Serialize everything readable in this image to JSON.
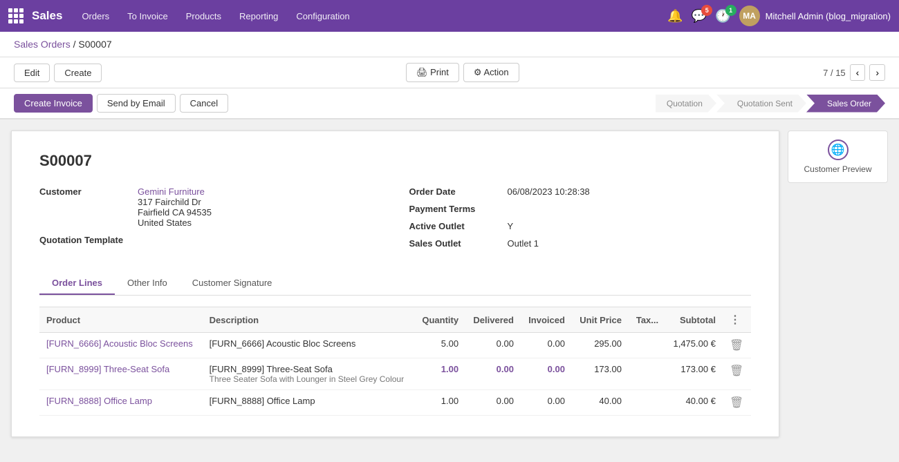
{
  "topnav": {
    "app_name": "Sales",
    "links": [
      "Orders",
      "To Invoice",
      "Products",
      "Reporting",
      "Configuration"
    ],
    "user_name": "Mitchell Admin (blog_migration)",
    "notif_count": "5",
    "msg_count": "1"
  },
  "breadcrumb": {
    "parent": "Sales Orders",
    "current": "S00007"
  },
  "toolbar": {
    "edit_label": "Edit",
    "create_label": "Create",
    "print_label": "Print",
    "action_label": "Action",
    "create_invoice_label": "Create Invoice",
    "send_email_label": "Send by Email",
    "cancel_label": "Cancel",
    "pagination_text": "7 / 15"
  },
  "status_steps": [
    {
      "label": "Quotation",
      "active": false
    },
    {
      "label": "Quotation Sent",
      "active": false
    },
    {
      "label": "Sales Order",
      "active": true
    }
  ],
  "customer_preview": {
    "label": "Customer Preview"
  },
  "document": {
    "order_number": "S00007",
    "customer_label": "Customer",
    "customer_name": "Gemini Furniture",
    "customer_address_1": "317 Fairchild Dr",
    "customer_address_2": "Fairfield CA 94535",
    "customer_address_3": "United States",
    "quotation_template_label": "Quotation Template",
    "order_date_label": "Order Date",
    "order_date_value": "06/08/2023 10:28:38",
    "payment_terms_label": "Payment Terms",
    "payment_terms_value": "",
    "active_outlet_label": "Active Outlet",
    "active_outlet_value": "Y",
    "sales_outlet_label": "Sales Outlet",
    "sales_outlet_value": "Outlet 1"
  },
  "tabs": [
    {
      "label": "Order Lines",
      "active": true
    },
    {
      "label": "Other Info",
      "active": false
    },
    {
      "label": "Customer Signature",
      "active": false
    }
  ],
  "table": {
    "headers": [
      "Product",
      "Description",
      "Quantity",
      "Delivered",
      "Invoiced",
      "Unit Price",
      "Tax...",
      "Subtotal"
    ],
    "rows": [
      {
        "product": "[FURN_6666] Acoustic Bloc Screens",
        "description": "[FURN_6666] Acoustic Bloc Screens",
        "quantity": "5.00",
        "delivered": "0.00",
        "invoiced": "0.00",
        "unit_price": "295.00",
        "tax": "",
        "subtotal": "1,475.00 €",
        "is_bold": false
      },
      {
        "product": "[FURN_8999] Three-Seat Sofa",
        "description": "[FURN_8999] Three-Seat Sofa\nThree Seater Sofa with Lounger in Steel Grey Colour",
        "quantity": "1.00",
        "delivered": "0.00",
        "invoiced": "0.00",
        "unit_price": "173.00",
        "tax": "",
        "subtotal": "173.00 €",
        "is_bold": true
      },
      {
        "product": "[FURN_8888] Office Lamp",
        "description": "[FURN_8888] Office Lamp",
        "quantity": "1.00",
        "delivered": "0.00",
        "invoiced": "0.00",
        "unit_price": "40.00",
        "tax": "",
        "subtotal": "40.00 €",
        "is_bold": false
      }
    ]
  }
}
